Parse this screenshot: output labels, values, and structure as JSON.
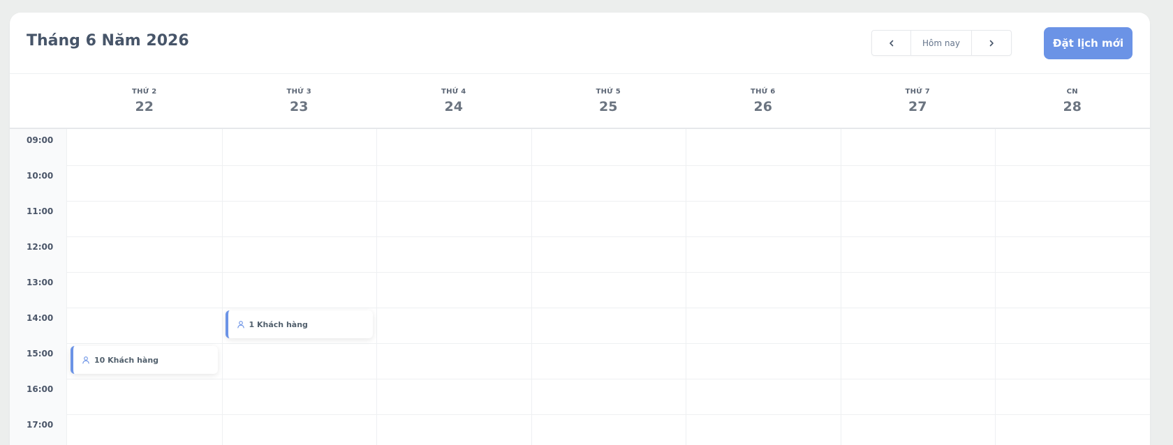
{
  "header": {
    "title": "Tháng 6 Năm 2026",
    "nav_prev_icon": "chevron-left-icon",
    "today_label": "Hôm nay",
    "nav_next_icon": "chevron-right-icon",
    "new_booking_label": "Đặt lịch mới"
  },
  "days": [
    {
      "name": "THỨ 2",
      "date": "22"
    },
    {
      "name": "THỨ 3",
      "date": "23"
    },
    {
      "name": "THỨ 4",
      "date": "24"
    },
    {
      "name": "THỨ 5",
      "date": "25"
    },
    {
      "name": "THỨ 6",
      "date": "26"
    },
    {
      "name": "THỨ 7",
      "date": "27"
    },
    {
      "name": "CN",
      "date": "28"
    }
  ],
  "times": [
    "09:00",
    "10:00",
    "11:00",
    "12:00",
    "13:00",
    "14:00",
    "15:00",
    "16:00",
    "17:00"
  ],
  "events": [
    {
      "label": "10 Khách hàng",
      "icon": "user-icon",
      "day": "22",
      "start": "15:00"
    },
    {
      "label": "1 Khách hàng",
      "icon": "user-icon",
      "day": "23",
      "start": "14:00"
    }
  ],
  "colors": {
    "accent": "#6b93e6",
    "background": "#eceeed",
    "card": "#ffffff",
    "grid_line": "#eef0f2"
  }
}
